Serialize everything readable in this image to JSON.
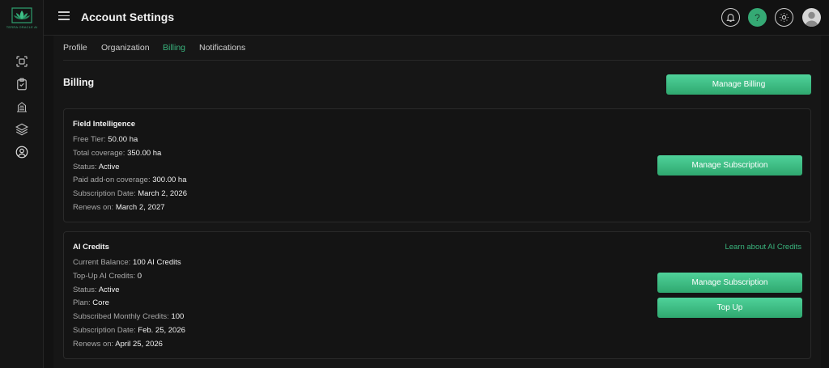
{
  "app": {
    "logo_text": "TERRA ORACLE AI"
  },
  "topbar": {
    "title": "Account Settings"
  },
  "tabs": [
    {
      "label": "Profile"
    },
    {
      "label": "Organization"
    },
    {
      "label": "Billing"
    },
    {
      "label": "Notifications"
    }
  ],
  "active_tab": "Billing",
  "billing": {
    "title": "Billing",
    "manage_billing_label": "Manage Billing",
    "field_intelligence": {
      "title": "Field Intelligence",
      "rows": [
        {
          "label": "Free Tier:",
          "value": "50.00 ha"
        },
        {
          "label": "Total coverage:",
          "value": "350.00 ha"
        },
        {
          "label": "Status:",
          "value": "Active"
        },
        {
          "label": "Paid add-on coverage:",
          "value": "300.00 ha"
        },
        {
          "label": "Subscription Date:",
          "value": "March 2, 2026"
        },
        {
          "label": "Renews on:",
          "value": "March 2, 2027"
        }
      ],
      "manage_subscription_label": "Manage Subscription"
    },
    "ai_credits": {
      "title": "AI Credits",
      "learn_link": "Learn about AI Credits",
      "rows": [
        {
          "label": "Current Balance:",
          "value": "100 AI Credits"
        },
        {
          "label": "Top-Up AI Credits:",
          "value": "0"
        },
        {
          "label": "Status:",
          "value": "Active"
        },
        {
          "label": "Plan:",
          "value": "Core"
        },
        {
          "label": "Subscribed Monthly Credits:",
          "value": "100"
        },
        {
          "label": "Subscription Date:",
          "value": "Feb. 25, 2026"
        },
        {
          "label": "Renews on:",
          "value": "April 25, 2026"
        }
      ],
      "manage_subscription_label": "Manage Subscription",
      "top_up_label": "Top Up"
    }
  },
  "colors": {
    "accent": "#39b47d",
    "button": "#3cc287",
    "background": "#121212"
  },
  "icons": [
    "logo-lotus-icon",
    "scan-icon",
    "clipboard-check-icon",
    "farm-icon",
    "layers-icon",
    "user-circle-icon",
    "menu-icon",
    "bell-icon",
    "help-icon",
    "sun-icon",
    "avatar-icon"
  ]
}
